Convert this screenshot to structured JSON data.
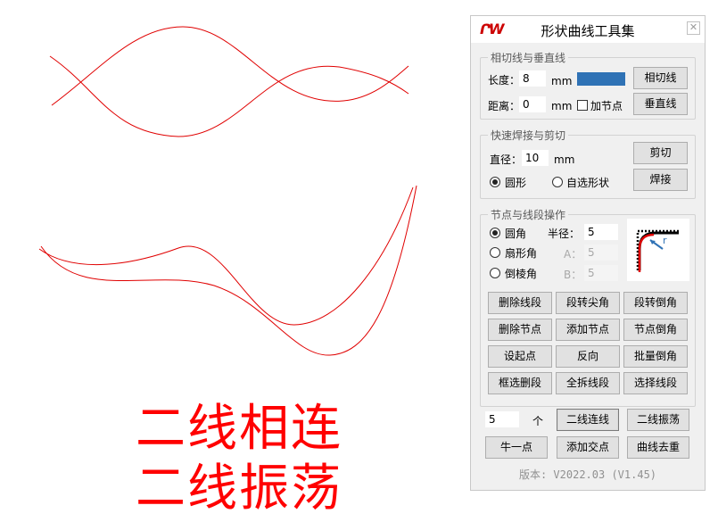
{
  "canvas": {
    "big_text_line1": "二线相连",
    "big_text_line2": "二线振荡",
    "curve_color": "#e00000",
    "text_color": "#ff0000"
  },
  "panel": {
    "logo": "ՐW",
    "title": "形状曲线工具集",
    "close_icon": "close-icon",
    "tangent_group": {
      "legend": "相切线与垂直线",
      "length_label": "长度：",
      "length_value": "8",
      "length_unit": "mm",
      "distance_label": "距离：",
      "distance_value": "0",
      "distance_unit": "mm",
      "add_node_label": "加节点",
      "add_node_checked": false,
      "color_swatch": "#2f72b5",
      "tangent_button": "相切线",
      "vertical_button": "垂直线"
    },
    "weld_group": {
      "legend": "快速焊接与剪切",
      "diameter_label": "直径：",
      "diameter_value": "10",
      "diameter_unit": "mm",
      "circle_label": "圆形",
      "custom_shape_label": "自选形状",
      "selected": "circle",
      "cut_button": "剪切",
      "weld_button": "焊接"
    },
    "node_group": {
      "legend": "节点与线段操作",
      "round_label": "圆角",
      "radius_label": "半径：",
      "radius_value": "5",
      "fan_label": "扇形角",
      "a_label": "A：",
      "a_value": "5",
      "chamfer_label": "倒棱角",
      "b_label": "B：",
      "b_value": "5",
      "selected": "round",
      "preview_label": "r",
      "buttons": [
        [
          "删除线段",
          "段转尖角",
          "段转倒角"
        ],
        [
          "删除节点",
          "添加节点",
          "节点倒角"
        ],
        [
          "设起点",
          "反向",
          "批量倒角"
        ],
        [
          "框选删段",
          "全拆线段",
          "选择线段"
        ]
      ]
    },
    "bottom": {
      "count_value": "5",
      "count_unit": "个",
      "connect_button": "二线连线",
      "oscillate_button": "二线振荡",
      "one_point_button": "牛一点",
      "add_intersection_button": "添加交点",
      "dedupe_button": "曲线去重"
    },
    "version": "版本: V2022.03 (V1.45)"
  }
}
